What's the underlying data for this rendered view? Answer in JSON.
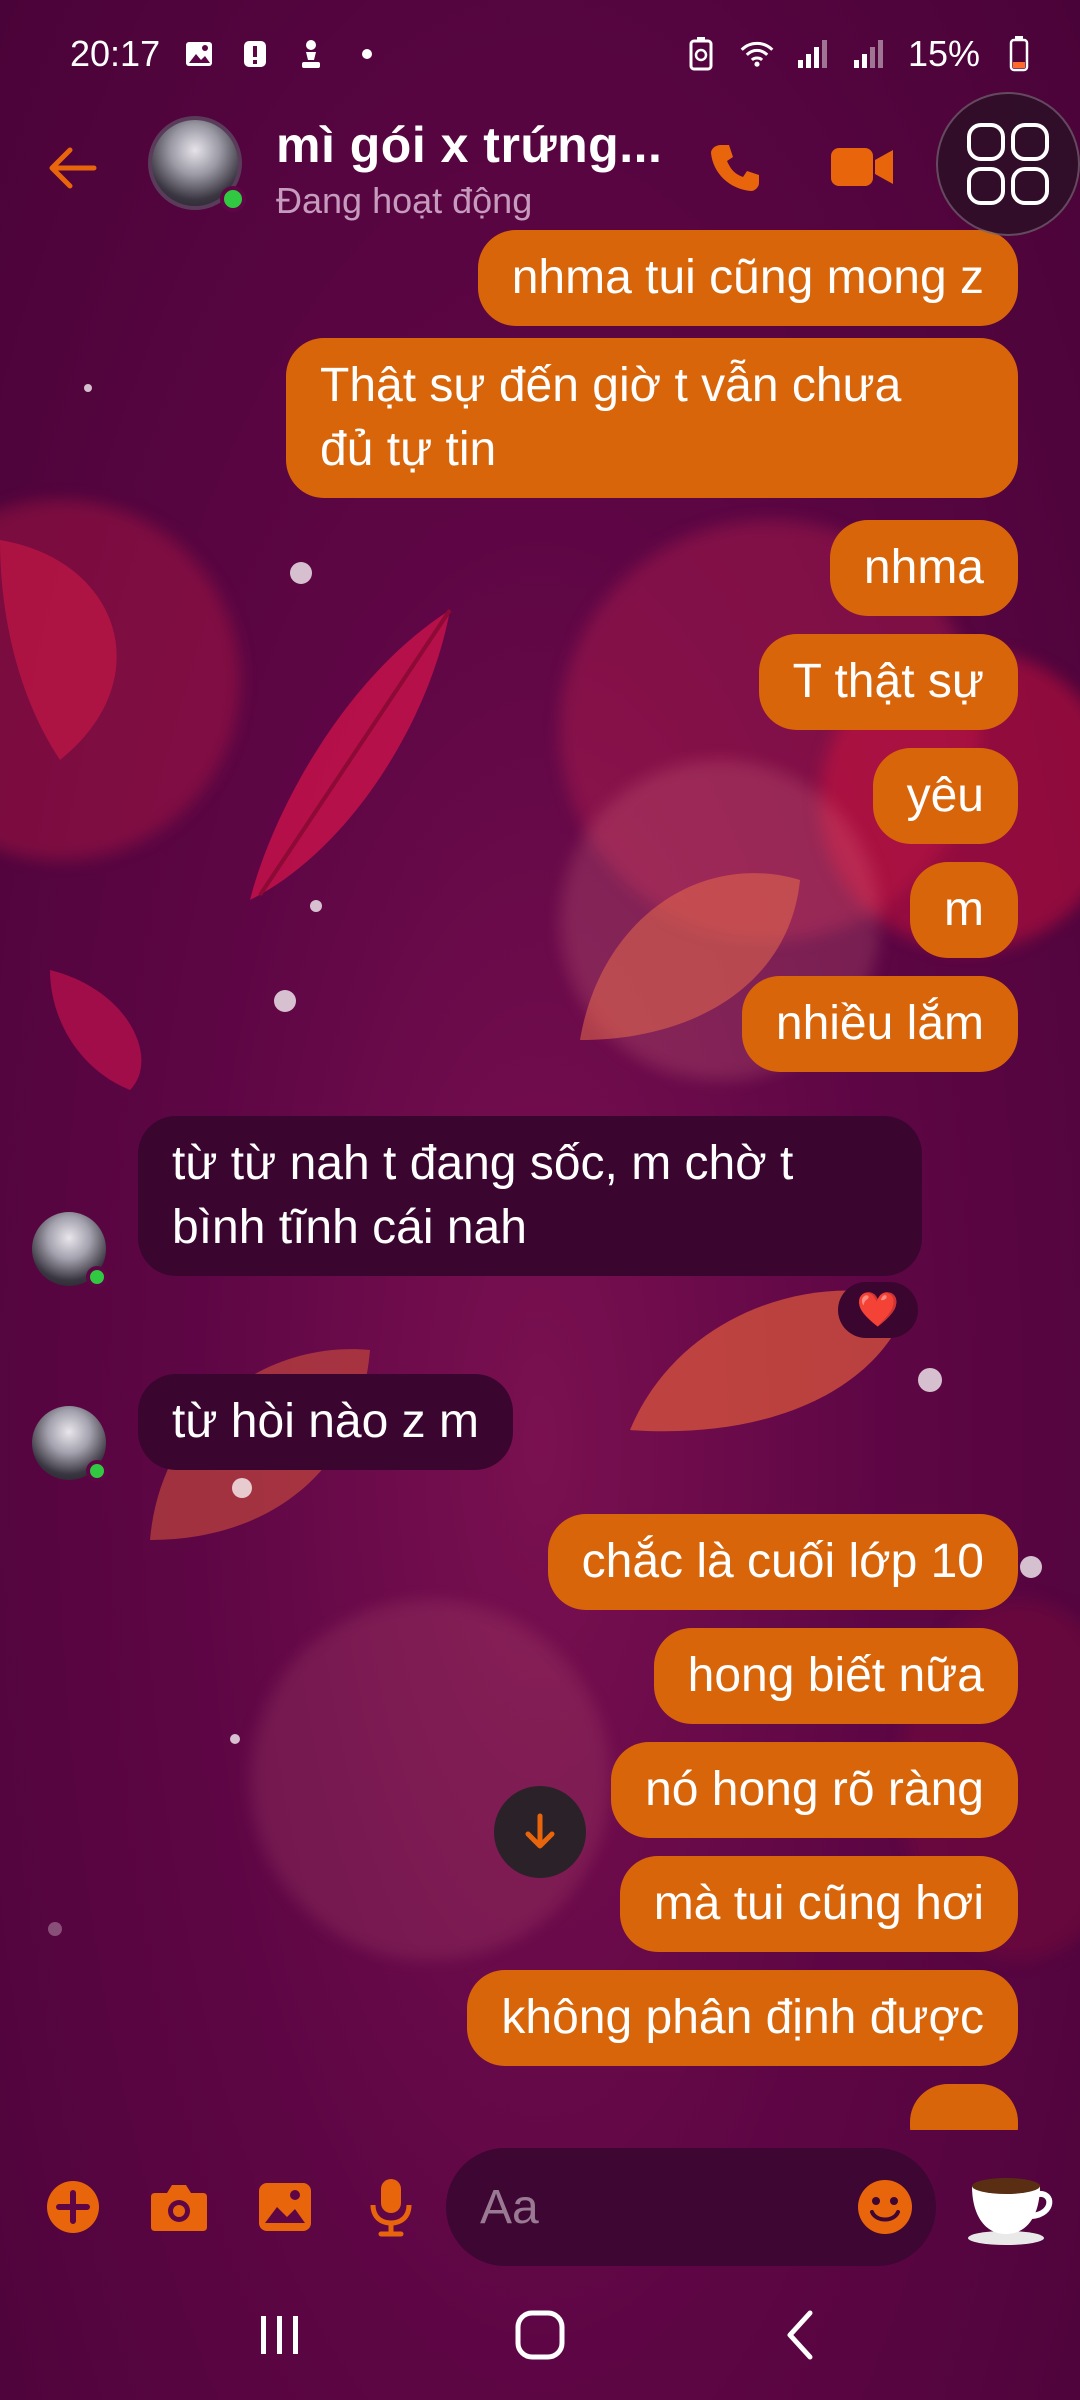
{
  "status_bar": {
    "time": "20:17",
    "battery": "15%",
    "icons_left": [
      "image-icon",
      "alert-icon",
      "pawn-icon",
      "dot-icon"
    ],
    "icons_right": [
      "battery-saver-icon",
      "wifi-icon",
      "signal-icon",
      "signal-icon"
    ]
  },
  "header": {
    "contact_name": "mì gói x trứng...",
    "status": "Đang hoạt động"
  },
  "messages": [
    {
      "side": "out",
      "text": "nhma tui cũng mong z"
    },
    {
      "side": "out",
      "text": "Thật sự đến giờ t vẫn chưa\nđủ tự tin"
    },
    {
      "side": "out",
      "text": "nhma"
    },
    {
      "side": "out",
      "text": "T thật sự"
    },
    {
      "side": "out",
      "text": "yêu"
    },
    {
      "side": "out",
      "text": "m"
    },
    {
      "side": "out",
      "text": "nhiều lắm"
    },
    {
      "side": "in",
      "text": "từ từ nah t đang sốc, m chờ t\nbình tĩnh cái nah",
      "reaction": "❤️"
    },
    {
      "side": "in",
      "text": "từ hòi nào z m"
    },
    {
      "side": "out",
      "text": "chắc là cuối lớp 10"
    },
    {
      "side": "out",
      "text": "hong biết nữa"
    },
    {
      "side": "out",
      "text": "nó hong rõ ràng"
    },
    {
      "side": "out",
      "text": "mà tui cũng hơi"
    },
    {
      "side": "out",
      "text": "không phân định được"
    }
  ],
  "composer": {
    "placeholder": "Aa"
  },
  "colors": {
    "accent": "#e8650c",
    "outgoing_bubble": "#d9650a",
    "incoming_bubble": "#3a0630",
    "background": "#5e0645",
    "online": "#31c842"
  }
}
